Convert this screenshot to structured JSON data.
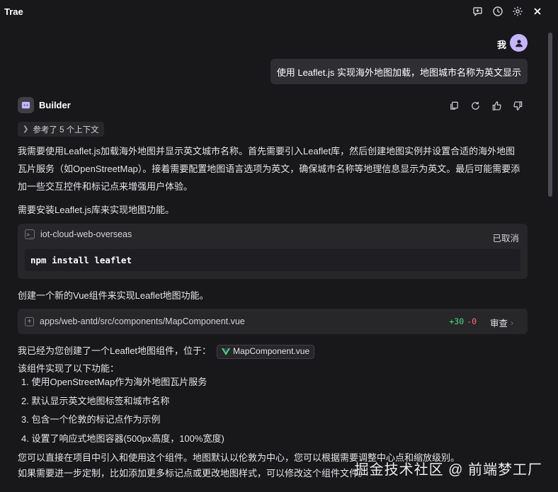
{
  "window": {
    "title": "Trae"
  },
  "titlebar": {
    "icons": [
      "new-chat-icon",
      "history-icon",
      "settings-icon",
      "close-icon"
    ]
  },
  "user": {
    "name": "我"
  },
  "user_message": "使用 Leaflet.js 实现海外地图加载，地图城市名称为英文显示",
  "assistant": {
    "name": "Builder",
    "context_chip": "参考了 5 个上下文",
    "intro_line1": "我需要使用Leaflet.js加载海外地图并显示英文城市名称。首先需要引入Leaflet库，然后创建地图实例并设置合适的海外地图",
    "intro_line2": "瓦片服务（如OpenStreetMap）。接着需要配置地图语言选项为英文，确保城市名称等地理信息显示为英文。最后可能需要添",
    "intro_line3": "加一些交互控件和标记点来增强用户体验。",
    "install_note": "需要安装Leaflet.js库来实现地图功能。",
    "terminal": {
      "project": "iot-cloud-web-overseas",
      "status": "已取消",
      "command": "npm install leaflet"
    },
    "create_note": "创建一个新的Vue组件来实现Leaflet地图功能。",
    "file_change": {
      "path": "apps/web-antd/src/components/MapComponent.vue",
      "added": "+30",
      "removed": "-0",
      "review_label": "审查"
    },
    "created_text": "我已经为您创建了一个Leaflet地图组件，位于：",
    "component_chip": "MapComponent.vue",
    "features_intro": "该组件实现了以下功能：",
    "features": [
      "1. 使用OpenStreetMap作为海外地图瓦片服务",
      "2. 默认显示英文地图标签和城市名称",
      "3. 包含一个伦敦的标记点作为示例",
      "4. 设置了响应式地图容器(500px高度，100%宽度)"
    ],
    "outro_line1": "您可以直接在项目中引入和使用这个组件。地图默认以伦敦为中心，您可以根据需要调整中心点和缩放级别。",
    "outro_line2": "如果需要进一步定制，比如添加更多标记点或更改地图样式，可以修改这个组件文件。"
  },
  "watermark": "掘金技术社区 @ 前端梦工厂",
  "colors": {
    "background": "#18181b",
    "card": "#27272a",
    "diff_added": "#4ade80",
    "diff_removed": "#f87171",
    "user_avatar": "#c4b5fd"
  }
}
